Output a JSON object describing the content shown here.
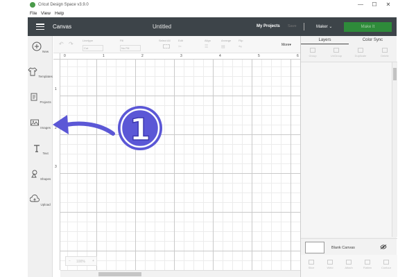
{
  "window": {
    "title": "Cricut Design Space  v3.9.0",
    "controls": [
      "—",
      "☐",
      "✕"
    ]
  },
  "menu": [
    "File",
    "View",
    "Help"
  ],
  "header": {
    "section": "Canvas",
    "doc_title": "Untitled",
    "my_projects": "My Projects",
    "save": "Save",
    "machine": "Maker",
    "make_it": "Make It"
  },
  "leftbar": {
    "items": [
      {
        "label": "New",
        "icon": "plus-icon"
      },
      {
        "label": "Templates",
        "icon": "shirt-icon"
      },
      {
        "label": "Projects",
        "icon": "projects-icon"
      },
      {
        "label": "Images",
        "icon": "image-icon"
      },
      {
        "label": "Text",
        "icon": "text-icon"
      },
      {
        "label": "Shapes",
        "icon": "shapes-icon"
      },
      {
        "label": "Upload",
        "icon": "upload-icon"
      }
    ]
  },
  "toolbar": {
    "linetype": "Linetype",
    "linetype_value": "Cut",
    "fill": "Fill",
    "fill_value": "No Fill",
    "select_all": "Select All",
    "edit": "Edit",
    "align": "Align",
    "arrange": "Arrange",
    "flip": "Flip",
    "more": "More▾"
  },
  "ruler": {
    "h_ticks": [
      "0",
      "1",
      "2",
      "3",
      "4",
      "5",
      "6"
    ],
    "v_ticks": [
      "1",
      "2",
      "3"
    ]
  },
  "zoom": {
    "value": "100%",
    "minus": "−",
    "plus": "+"
  },
  "rpanel": {
    "tabs": [
      "Layers",
      "Color Sync"
    ],
    "actions": [
      "Group",
      "UnGroup",
      "Duplicate",
      "Delete"
    ],
    "blank_canvas": "Blank Canvas",
    "bottom_actions": [
      "Slice",
      "Weld",
      "Attach",
      "Flatten",
      "Contour"
    ]
  },
  "annotation": {
    "number": "1",
    "color": "#5b57d6"
  }
}
